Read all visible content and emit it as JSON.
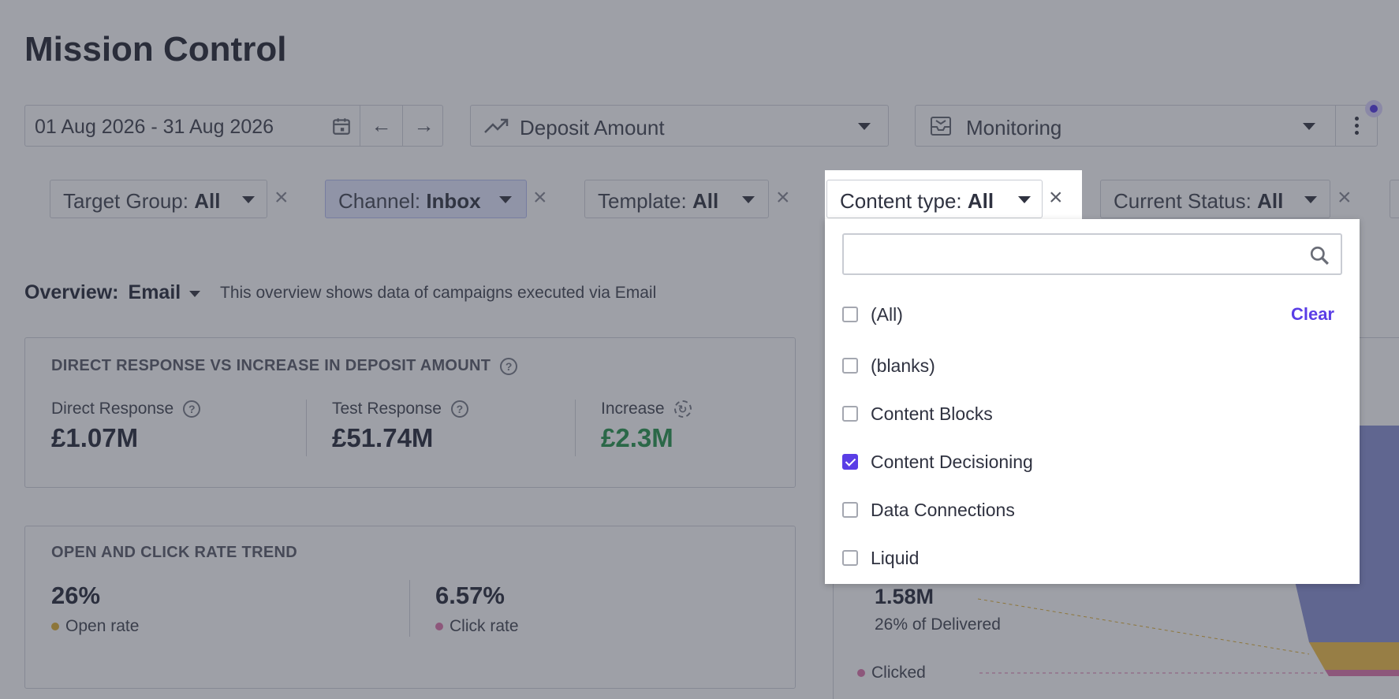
{
  "page": {
    "title": "Mission Control"
  },
  "toolbar": {
    "date_range": "01 Aug 2026 - 31 Aug 2026",
    "metric": "Deposit Amount",
    "view": "Monitoring"
  },
  "filters": [
    {
      "label": "Target Group:",
      "value": "All"
    },
    {
      "label": "Channel:",
      "value": "Inbox"
    },
    {
      "label": "Template:",
      "value": "All"
    },
    {
      "label": "Content type:",
      "value": "All"
    },
    {
      "label": "Current Status:",
      "value": "All"
    }
  ],
  "overview": {
    "label": "Overview:",
    "value": "Email",
    "description": "This overview shows data of campaigns executed via Email"
  },
  "card1": {
    "title": "DIRECT RESPONSE VS INCREASE IN DEPOSIT AMOUNT",
    "stats": [
      {
        "label": "Direct Response",
        "value": "£1.07M"
      },
      {
        "label": "Test Response",
        "value": "£51.74M"
      },
      {
        "label": "Increase",
        "value": "£2.3M"
      }
    ]
  },
  "card2": {
    "title": "OPEN AND CLICK RATE TREND",
    "stats": [
      {
        "label": "Open rate",
        "value": "26%",
        "color": "#e0b23a"
      },
      {
        "label": "Click rate",
        "value": "6.57%",
        "color": "#e07bb0"
      }
    ]
  },
  "funnel": {
    "value": "1.58M",
    "subtitle": "26% of Delivered",
    "clicked_label": "Clicked"
  },
  "dropdown": {
    "search_placeholder": "",
    "clear_label": "Clear",
    "options": [
      {
        "label": "(All)",
        "checked": false
      },
      {
        "label": "(blanks)",
        "checked": false
      },
      {
        "label": "Content Blocks",
        "checked": false
      },
      {
        "label": "Content Decisioning",
        "checked": true
      },
      {
        "label": "Data Connections",
        "checked": false
      },
      {
        "label": "Liquid",
        "checked": false
      }
    ]
  },
  "colors": {
    "accent": "#5a3ee6",
    "increase_green": "#2e9a52",
    "overlay": "#282c3c"
  }
}
